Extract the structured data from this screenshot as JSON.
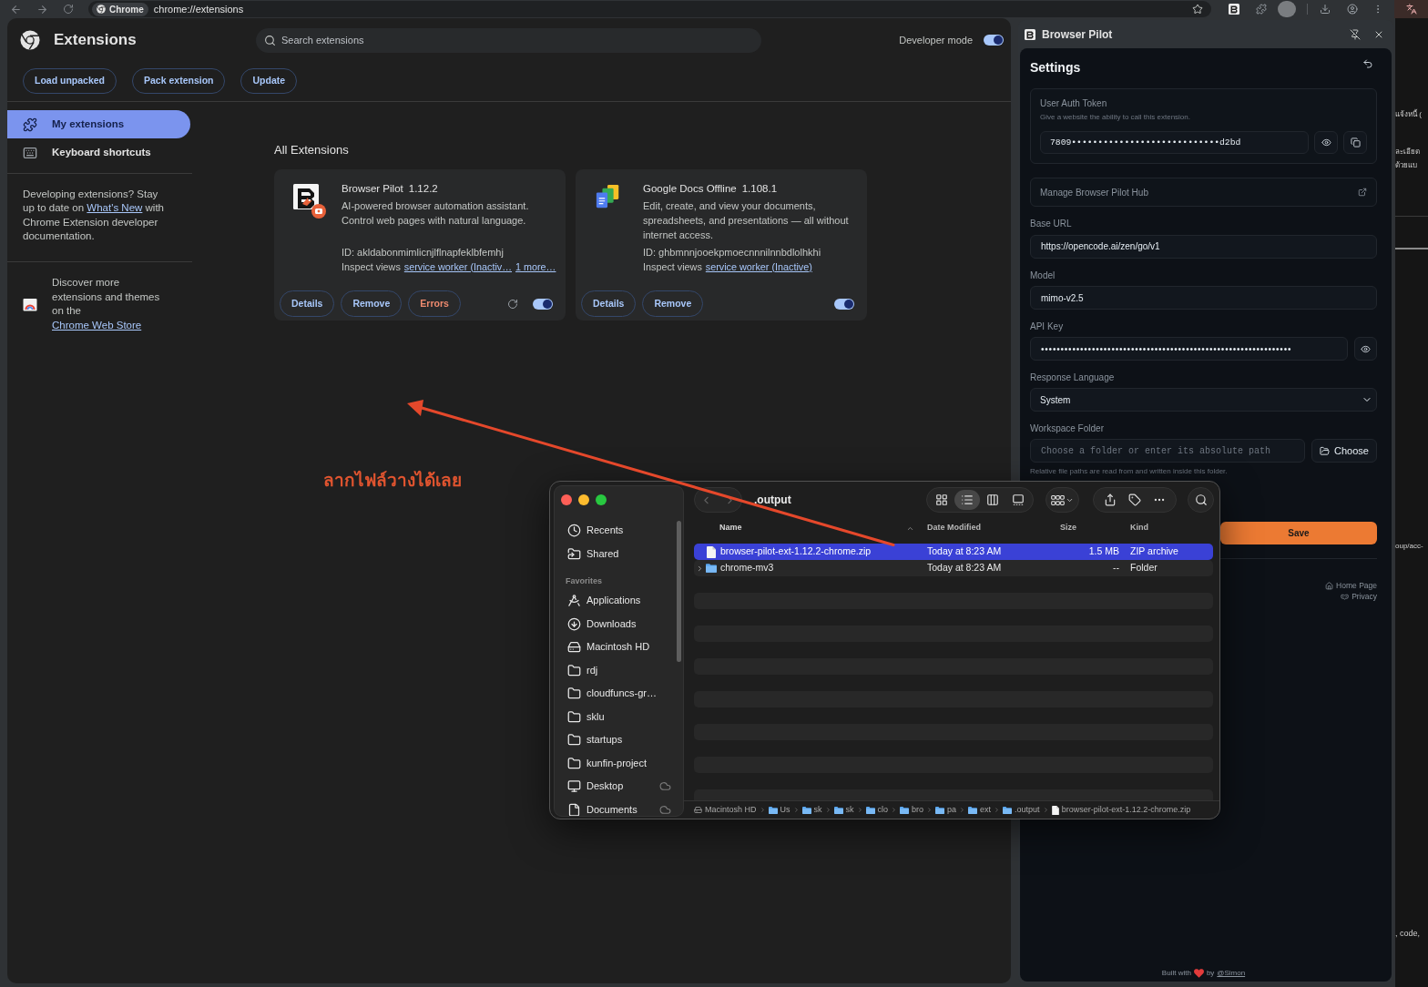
{
  "browser_toolbar": {
    "tab_chip": "Chrome",
    "address": "chrome://extensions"
  },
  "extensions_page": {
    "title": "Extensions",
    "search": {
      "placeholder": "Search extensions"
    },
    "developer_mode": {
      "label": "Developer mode",
      "on": true
    },
    "actions": [
      "Load unpacked",
      "Pack extension",
      "Update"
    ],
    "sidebar": {
      "items": [
        {
          "label": "My extensions",
          "kind": "extensions",
          "selected": true
        },
        {
          "label": "Keyboard shortcuts",
          "kind": "shortcuts",
          "selected": false
        }
      ],
      "developer_note": {
        "before": "Developing extensions? Stay up to date on",
        "link": "What's New",
        "after": "with Chrome Extension developer documentation."
      },
      "store_note": {
        "before": "Discover more extensions and themes on the",
        "link": "Chrome Web Store"
      }
    },
    "section_title": "All Extensions",
    "extensions": [
      {
        "name": "Browser Pilot",
        "version": "1.12.2",
        "description": "AI-powered browser automation assistant. Control web pages with natural language.",
        "id": "ID: akldabonmimlicnjlflnapfeklbfemhj",
        "inspect_label": "Inspect views",
        "inspect_links": [
          "service worker (Inactiv…",
          "1 more…"
        ],
        "buttons": [
          {
            "label": "Details",
            "kind": "normal"
          },
          {
            "label": "Remove",
            "kind": "normal"
          },
          {
            "label": "Errors",
            "kind": "error"
          }
        ],
        "reload": true,
        "enabled": true
      },
      {
        "name": "Google Docs Offline",
        "version": "1.108.1",
        "description": "Edit, create, and view your documents, spreadsheets, and presentations — all without internet access.",
        "id": "ID: ghbmnnjooekpmoecnnnilnnbdlolhkhi",
        "inspect_label": "Inspect views",
        "inspect_links": [
          "service worker (Inactive)"
        ],
        "buttons": [
          {
            "label": "Details",
            "kind": "normal"
          },
          {
            "label": "Remove",
            "kind": "normal"
          }
        ],
        "reload": false,
        "enabled": true
      }
    ]
  },
  "side_panel": {
    "title": "Browser Pilot",
    "settings": {
      "title": "Settings",
      "auth_token": {
        "title": "User Auth Token",
        "description": "Give a website the ability to call this extension.",
        "value": "7809••••••••••••••••••••••••••••d2bd"
      },
      "hub_link": "Manage Browser Pilot Hub",
      "fields": [
        {
          "kind": "text",
          "label": "Base URL",
          "value": "https://opencode.ai/zen/go/v1"
        },
        {
          "kind": "text",
          "label": "Model",
          "value": "mimo-v2.5"
        },
        {
          "kind": "secret",
          "label": "API Key",
          "value": "••••••••••••••••••••••••••••••••••••••••••••••••••••••••••••••••"
        },
        {
          "kind": "select",
          "label": "Response Language",
          "value": "System"
        },
        {
          "kind": "folder",
          "label": "Workspace Folder",
          "placeholder": "Choose a folder or enter its absolute path",
          "button": "Choose",
          "hint": "Relative file paths are read from and written inside this folder."
        }
      ],
      "save_button": "Save",
      "footer_links": [
        {
          "label": "Home Page",
          "kind": "home"
        },
        {
          "label": "Privacy",
          "kind": "privacy"
        }
      ],
      "credit": {
        "before": "Built with",
        "middle": "by",
        "link": "@Simon"
      }
    }
  },
  "finder": {
    "title": ".output",
    "nav_buttons": [
      {
        "kind": "back",
        "disabled": true
      },
      {
        "kind": "forward",
        "disabled": true
      }
    ],
    "view_modes": [
      {
        "kind": "icons",
        "selected": false
      },
      {
        "kind": "list",
        "selected": true
      },
      {
        "kind": "columns",
        "selected": false
      },
      {
        "kind": "gallery",
        "selected": false
      }
    ],
    "sidebar": {
      "top_items": [
        {
          "label": "Recents",
          "kind": "recents",
          "cloud": false
        },
        {
          "label": "Shared",
          "kind": "shared",
          "cloud": false
        }
      ],
      "favorites_heading": "Favorites",
      "favorites": [
        {
          "label": "Applications",
          "kind": "applications",
          "cloud": false
        },
        {
          "label": "Downloads",
          "kind": "downloads",
          "cloud": false
        },
        {
          "label": "Macintosh HD",
          "kind": "disk",
          "cloud": false
        },
        {
          "label": "rdj",
          "kind": "folder",
          "cloud": false
        },
        {
          "label": "cloudfuncs-gr…",
          "kind": "folder",
          "cloud": false
        },
        {
          "label": "sklu",
          "kind": "folder",
          "cloud": false
        },
        {
          "label": "startups",
          "kind": "folder",
          "cloud": false
        },
        {
          "label": "kunfin-project",
          "kind": "folder",
          "cloud": false
        },
        {
          "label": "Desktop",
          "kind": "desktop",
          "cloud": true
        },
        {
          "label": "Documents",
          "kind": "documents",
          "cloud": true
        }
      ]
    },
    "columns": [
      {
        "label": "Name",
        "sorted": true
      },
      {
        "label": "Date Modified",
        "sorted": false
      },
      {
        "label": "Size",
        "sorted": false
      },
      {
        "label": "Kind",
        "sorted": false
      }
    ],
    "rows": [
      {
        "kind": "file",
        "name": "browser-pilot-ext-1.12.2-chrome.zip",
        "date_modified": "Today at 8:23 AM",
        "size": "1.5 MB",
        "file_type": "ZIP archive",
        "selected": true
      },
      {
        "kind": "folder",
        "name": "chrome-mv3",
        "date_modified": "Today at 8:23 AM",
        "size": "--",
        "file_type": "Folder",
        "selected": false
      }
    ],
    "path": [
      {
        "label": "Macintosh HD",
        "kind": "disk"
      },
      {
        "label": "Us",
        "kind": "folder"
      },
      {
        "label": "sk",
        "kind": "folder"
      },
      {
        "label": "sk",
        "kind": "folder"
      },
      {
        "label": "clo",
        "kind": "folder"
      },
      {
        "label": "bro",
        "kind": "folder"
      },
      {
        "label": "pa",
        "kind": "folder"
      },
      {
        "label": "ext",
        "kind": "folder"
      },
      {
        "label": ".output",
        "kind": "folder"
      },
      {
        "label": "browser-pilot-ext-1.12.2-chrome.zip",
        "kind": "file"
      }
    ]
  },
  "annotation": {
    "text": "ลากไฟล์วางได้เลย"
  },
  "background_page": {
    "fragments": [
      "แจ้งหนี้ (",
      "ละเอียด",
      "ด้วยแบ",
      "oup/acc-",
      ", code,"
    ]
  }
}
